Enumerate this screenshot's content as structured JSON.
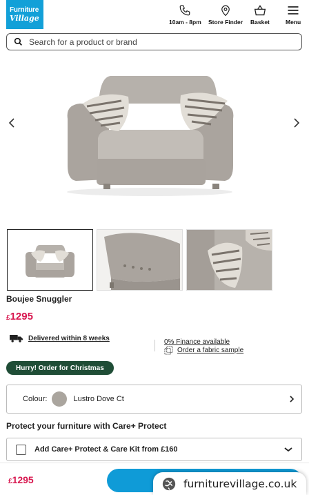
{
  "header": {
    "logo_line1": "Furniture",
    "logo_line2": "Village",
    "nav": [
      {
        "label": "10am - 8pm",
        "icon": "phone-icon"
      },
      {
        "label": "Store Finder",
        "icon": "location-pin-icon"
      },
      {
        "label": "Basket",
        "icon": "basket-icon"
      },
      {
        "label": "Menu",
        "icon": "hamburger-menu-icon"
      }
    ]
  },
  "search": {
    "placeholder": "Search for a product or brand"
  },
  "product": {
    "name": "Boujee Snuggler",
    "currency": "£",
    "price": "1295"
  },
  "delivery": {
    "delivered_text": "Delivered within 8 weeks",
    "finance_text": "0% Finance available",
    "sample_text": "Order a fabric sample"
  },
  "badge": {
    "text": "Hurry! Order for Christmas"
  },
  "colour": {
    "label": "Colour:",
    "value": "Lustro Dove Ct",
    "swatch": "#aaa59e"
  },
  "care": {
    "title": "Protect your furniture with Care+ Protect",
    "option": "Add Care+ Protect & Care Kit from £160"
  },
  "bottom": {
    "currency": "£",
    "price": "1295",
    "url": "furniturevillage.co.uk"
  },
  "colors": {
    "accent": "#12a0d8",
    "price": "#d8174f",
    "badge": "#1f4d36"
  }
}
